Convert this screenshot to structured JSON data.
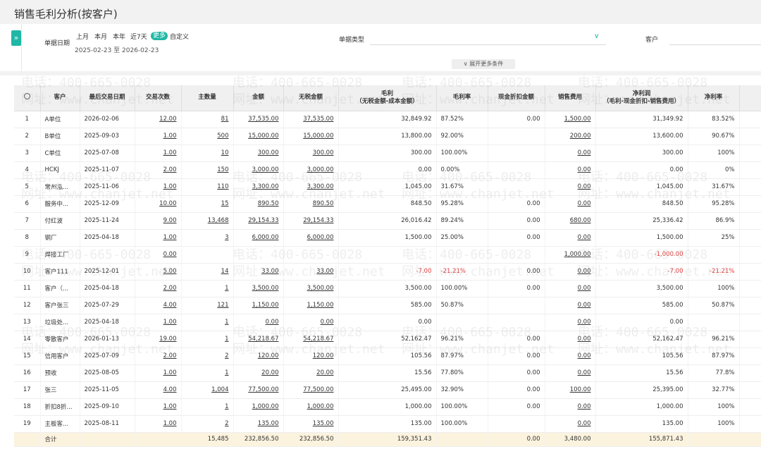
{
  "page": {
    "title": "销售毛利分析(按客户)"
  },
  "filters": {
    "toggle_icon": "»",
    "date_label": "单据日期",
    "quick_ranges": [
      "上月",
      "本月",
      "本年",
      "近7天",
      "更多",
      "自定义"
    ],
    "date_range": "2025-02-23 至 2026-02-23",
    "doc_type_label": "单据类型",
    "customer_label": "客户",
    "expand_label": "展开更多条件"
  },
  "table": {
    "headers": [
      "客户",
      "最后交易日期",
      "交易次数",
      "主数量",
      "金额",
      "无税金额",
      "毛利\n（无税金额-成本金额）",
      "毛利率",
      "现金折扣金额",
      "销售费用",
      "净利润\n（毛利-现金折扣-销售费用）",
      "净利率"
    ],
    "rows": [
      {
        "no": "1",
        "customer": "A单位",
        "date": "2026-02-06",
        "count": "12.00",
        "qty": "81",
        "amount": "37,535.00",
        "notax": "37,535.00",
        "gross": "32,849.92",
        "gross_rate": "87.52%",
        "discount": "0.00",
        "expense": "1,500.00",
        "net": "31,349.92",
        "net_rate": "83.52%"
      },
      {
        "no": "2",
        "customer": "B单位",
        "date": "2025-09-03",
        "count": "1.00",
        "qty": "500",
        "amount": "15,000.00",
        "notax": "15,000.00",
        "gross": "13,800.00",
        "gross_rate": "92.00%",
        "discount": "",
        "expense": "200.00",
        "net": "13,600.00",
        "net_rate": "90.67%"
      },
      {
        "no": "3",
        "customer": "C单位",
        "date": "2025-07-08",
        "count": "1.00",
        "qty": "10",
        "amount": "300.00",
        "notax": "300.00",
        "gross": "300.00",
        "gross_rate": "100.00%",
        "discount": "",
        "expense": "0.00",
        "net": "300.00",
        "net_rate": "100%"
      },
      {
        "no": "4",
        "customer": "HCKJ",
        "date": "2025-11-07",
        "count": "2.00",
        "qty": "150",
        "amount": "3,000.00",
        "notax": "3,000.00",
        "gross": "0.00",
        "gross_rate": "0.00%",
        "discount": "",
        "expense": "0.00",
        "net": "0.00",
        "net_rate": "0%"
      },
      {
        "no": "5",
        "customer": "常州泓...",
        "date": "2025-11-06",
        "count": "1.00",
        "qty": "110",
        "amount": "3,300.00",
        "notax": "3,300.00",
        "gross": "1,045.00",
        "gross_rate": "31.67%",
        "discount": "",
        "expense": "0.00",
        "net": "1,045.00",
        "net_rate": "31.67%"
      },
      {
        "no": "6",
        "customer": "服务中...",
        "date": "2025-12-09",
        "count": "10.00",
        "qty": "15",
        "amount": "890.50",
        "notax": "890.50",
        "gross": "848.50",
        "gross_rate": "95.28%",
        "discount": "0.00",
        "expense": "0.00",
        "net": "848.50",
        "net_rate": "95.28%"
      },
      {
        "no": "7",
        "customer": "付红波",
        "date": "2025-11-24",
        "count": "9.00",
        "qty": "13,468",
        "amount": "29,154.33",
        "notax": "29,154.33",
        "gross": "26,016.42",
        "gross_rate": "89.24%",
        "discount": "0.00",
        "expense": "680.00",
        "net": "25,336.42",
        "net_rate": "86.9%"
      },
      {
        "no": "8",
        "customer": "钢厂",
        "date": "2025-04-18",
        "count": "1.00",
        "qty": "3",
        "amount": "6,000.00",
        "notax": "6,000.00",
        "gross": "1,500.00",
        "gross_rate": "25.00%",
        "discount": "0.00",
        "expense": "0.00",
        "net": "1,500.00",
        "net_rate": "25%"
      },
      {
        "no": "9",
        "customer": "焊接工厂",
        "date": "",
        "count": "0.00",
        "qty": "",
        "amount": "",
        "notax": "",
        "gross": "",
        "gross_rate": "",
        "discount": "",
        "expense": "1,000.00",
        "net": "-1,000.00",
        "net_rate": ""
      },
      {
        "no": "10",
        "customer": "客户111",
        "date": "2025-12-01",
        "count": "5.00",
        "qty": "14",
        "amount": "33.00",
        "notax": "33.00",
        "gross": "-7.00",
        "gross_rate": "-21.21%",
        "discount": "0.00",
        "expense": "0.00",
        "net": "-7.00",
        "net_rate": "-21.21%"
      },
      {
        "no": "11",
        "customer": "客户（...",
        "date": "2025-04-18",
        "count": "2.00",
        "qty": "1",
        "amount": "3,500.00",
        "notax": "3,500.00",
        "gross": "3,500.00",
        "gross_rate": "100.00%",
        "discount": "0.00",
        "expense": "0.00",
        "net": "3,500.00",
        "net_rate": "100%"
      },
      {
        "no": "12",
        "customer": "客户张三",
        "date": "2025-07-29",
        "count": "4.00",
        "qty": "121",
        "amount": "1,150.00",
        "notax": "1,150.00",
        "gross": "585.00",
        "gross_rate": "50.87%",
        "discount": "",
        "expense": "0.00",
        "net": "585.00",
        "net_rate": "50.87%"
      },
      {
        "no": "13",
        "customer": "垃圾处...",
        "date": "2025-04-18",
        "count": "1.00",
        "qty": "1",
        "amount": "0.00",
        "notax": "0.00",
        "gross": "0.00",
        "gross_rate": "",
        "discount": "",
        "expense": "0.00",
        "net": "0.00",
        "net_rate": ""
      },
      {
        "no": "14",
        "customer": "零散客户",
        "date": "2026-01-13",
        "count": "19.00",
        "qty": "1",
        "amount": "54,218.67",
        "notax": "54,218.67",
        "gross": "52,162.47",
        "gross_rate": "96.21%",
        "discount": "0.00",
        "expense": "0.00",
        "net": "52,162.47",
        "net_rate": "96.21%"
      },
      {
        "no": "15",
        "customer": "信用客户",
        "date": "2025-07-09",
        "count": "2.00",
        "qty": "2",
        "amount": "120.00",
        "notax": "120.00",
        "gross": "105.56",
        "gross_rate": "87.97%",
        "discount": "0.00",
        "expense": "0.00",
        "net": "105.56",
        "net_rate": "87.97%"
      },
      {
        "no": "16",
        "customer": "预收",
        "date": "2025-08-05",
        "count": "1.00",
        "qty": "1",
        "amount": "20.00",
        "notax": "20.00",
        "gross": "15.56",
        "gross_rate": "77.80%",
        "discount": "0.00",
        "expense": "0.00",
        "net": "15.56",
        "net_rate": "77.8%"
      },
      {
        "no": "17",
        "customer": "张三",
        "date": "2025-11-05",
        "count": "4.00",
        "qty": "1,004",
        "amount": "77,500.00",
        "notax": "77,500.00",
        "gross": "25,495.00",
        "gross_rate": "32.90%",
        "discount": "0.00",
        "expense": "100.00",
        "net": "25,395.00",
        "net_rate": "32.77%"
      },
      {
        "no": "18",
        "customer": "折扣8折...",
        "date": "2025-09-10",
        "count": "1.00",
        "qty": "1",
        "amount": "1,000.00",
        "notax": "1,000.00",
        "gross": "1,000.00",
        "gross_rate": "100.00%",
        "discount": "0.00",
        "expense": "0.00",
        "net": "1,000.00",
        "net_rate": "100%"
      },
      {
        "no": "19",
        "customer": "主板客...",
        "date": "2025-08-11",
        "count": "1.00",
        "qty": "2",
        "amount": "135.00",
        "notax": "135.00",
        "gross": "135.00",
        "gross_rate": "100.00%",
        "discount": "",
        "expense": "0.00",
        "net": "135.00",
        "net_rate": "100%"
      }
    ],
    "total": {
      "label": "合计",
      "qty": "15,485",
      "amount": "232,856.50",
      "notax": "232,856.50",
      "gross": "159,351.43",
      "discount": "0.00",
      "expense": "3,480.00",
      "net": "155,871.43"
    }
  },
  "watermark": {
    "phone": "电话：400-665-0028",
    "site": "网址：www.chanjet.net"
  }
}
